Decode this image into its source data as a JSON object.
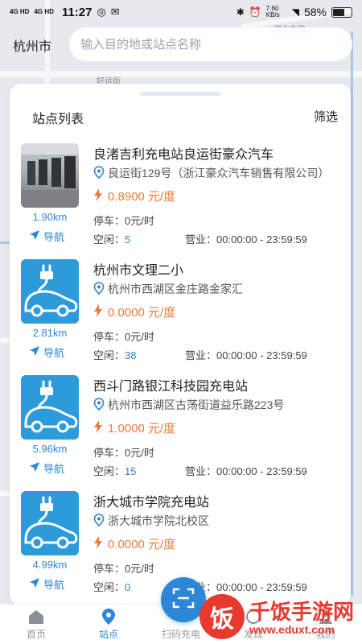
{
  "status_bar": {
    "network_1": "4G HD",
    "network_2": "4G HD",
    "time": "11:27",
    "speed": "7.60 KB/s",
    "battery": "58%"
  },
  "header": {
    "city": "杭州市",
    "search_placeholder": "输入目的地或站点名称"
  },
  "map": {
    "labels": [
      "好运街",
      "湖北东路"
    ]
  },
  "panel": {
    "title": "站点列表",
    "filter_label": "筛选"
  },
  "stations": [
    {
      "name": "良渚吉利充电站良运街豪众汽车",
      "address": "良运街129号（浙江豪众汽车销售有限公司）",
      "price": "0.8900 元/度",
      "distance": "1.90km",
      "nav_label": "导航",
      "parking_label": "停车：",
      "parking_value": "0元/时",
      "free_label": "空闲：",
      "free_value": "5",
      "hours_label": "营业：",
      "hours_value": "00:00:00 - 23:59:59",
      "thumb": "photo"
    },
    {
      "name": "杭州市文理二小",
      "address": "杭州市西湖区金庄路金家汇",
      "price": "0.0000 元/度",
      "distance": "2.81km",
      "nav_label": "导航",
      "parking_label": "停车：",
      "parking_value": "0元/时",
      "free_label": "空闲：",
      "free_value": "38",
      "hours_label": "营业：",
      "hours_value": "00:00:00 - 23:59:59",
      "thumb": "icon"
    },
    {
      "name": "西斗门路银江科技园充电站",
      "address": "杭州市西湖区古荡街道益乐路223号",
      "price": "1.0000 元/度",
      "distance": "5.96km",
      "nav_label": "导航",
      "parking_label": "停车：",
      "parking_value": "0元/时",
      "free_label": "空闲：",
      "free_value": "15",
      "hours_label": "营业：",
      "hours_value": "00:00:00 - 23:59:59",
      "thumb": "icon"
    },
    {
      "name": "浙大城市学院充电站",
      "address": "浙大城市学院北校区",
      "price": "0.0000 元/度",
      "distance": "4.99km",
      "nav_label": "导航",
      "parking_label": "停车：",
      "parking_value": "0元/时",
      "free_label": "空闲：",
      "free_value": "0",
      "hours_label": "营业：",
      "hours_value": "00:00:00 - 23:59:59",
      "thumb": "icon"
    }
  ],
  "bottom_nav": {
    "tabs": [
      {
        "label": "首页",
        "icon": "home-icon",
        "active": false
      },
      {
        "label": "站点",
        "icon": "location-pin-icon",
        "active": true
      },
      {
        "label": "扫码充电",
        "icon": "scan-icon",
        "active": false
      },
      {
        "label": "发现",
        "icon": "discover-icon",
        "active": false
      },
      {
        "label": "我的",
        "icon": "profile-icon",
        "active": false
      }
    ]
  },
  "watermark": {
    "logo_char": "饭",
    "title": "千饭手游网",
    "url": "www.eduxt.com"
  },
  "colors": {
    "accent": "#2d86d6",
    "price": "#ec7a3c",
    "thumb_bg": "#2d9bd9",
    "watermark": "#e8392e"
  }
}
